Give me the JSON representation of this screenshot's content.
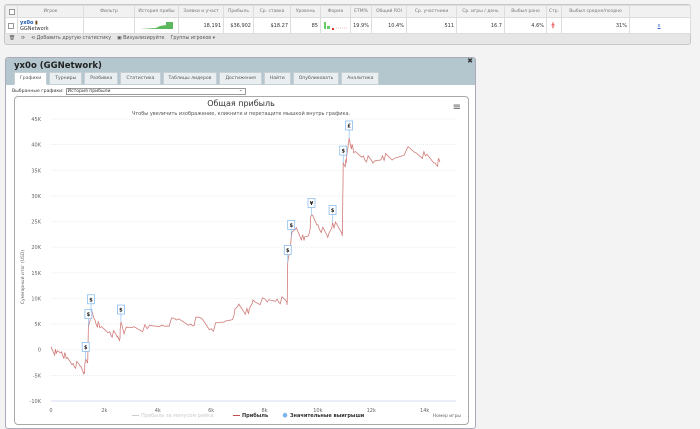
{
  "table": {
    "headers": [
      "",
      "Игрок",
      "Фильтр",
      "История прибы",
      "Заявки и участ",
      "Прибыль",
      "Ср. ставка",
      "Уровень",
      "Форма",
      "ЕТМ%",
      "Общий ROI",
      "Ср. участники",
      "Ср. игры / день",
      "Выбыл рано",
      "Стр.",
      "Выбыл средне/поздно",
      ""
    ],
    "row": {
      "player": "yx0o",
      "network": "GGNetwork",
      "entries": "18,191",
      "profit": "$36,902",
      "avg_stake": "$18.27",
      "level": "85",
      "etm": "19.9%",
      "roi": "10.4%",
      "avg_field": "511",
      "games_per_day": "16.7",
      "early": "4.6%",
      "late": "31%",
      "link": "x"
    },
    "toolbar": {
      "add_stat": "Добавить другую статистику",
      "visualize": "Визуализируйте",
      "groups": "Группы игроков ▾"
    }
  },
  "panel": {
    "title": "yx0o (GGNetwork)",
    "tabs": [
      "Графики",
      "Турниры",
      "Разбивка",
      "Статистика",
      "Таблицы лидеров",
      "Достижения",
      "Найти",
      "Опубликовать",
      "Аналитика"
    ],
    "active_tab": 0,
    "select_label": "Выбранные графики:",
    "select_value": "История прибыли"
  },
  "chart_data": {
    "type": "line",
    "title": "Общая прибыль",
    "subtitle": "Чтобы увеличить изображение, кликните и перетащите мышкой внутрь графика.",
    "xlabel": "Номер игры",
    "ylabel": "Суммарный итог (USD)",
    "xlim": [
      0,
      14800
    ],
    "ylim": [
      -10000,
      45000
    ],
    "xticks": [
      "0",
      "2k",
      "4k",
      "6k",
      "8k",
      "10k",
      "12k",
      "14k"
    ],
    "yticks": [
      "-10K",
      "-5K",
      "0",
      "5K",
      "10K",
      "15K",
      "20K",
      "25K",
      "30K",
      "35K",
      "40K",
      "45K"
    ],
    "grid": true,
    "legend": [
      "Прибыль за минусом рейка",
      "Прибыль",
      "Значительные выигрыши"
    ],
    "legend_position": "bottom",
    "colors": {
      "profit": "#c0504d",
      "rake": "#cccccc",
      "wins": "#7cb5ec"
    },
    "series": [
      {
        "name": "Прибыль",
        "x": [
          0,
          200,
          400,
          570,
          830,
          1100,
          1250,
          1300,
          1380,
          1400,
          1500,
          1650,
          1830,
          2200,
          2480,
          2580,
          2620,
          2760,
          3100,
          3600,
          4150,
          4700,
          5240,
          5600,
          6000,
          6500,
          6860,
          7040,
          7400,
          7570,
          8100,
          8470,
          8830,
          8850,
          8870,
          9000,
          9190,
          9480,
          9660,
          9760,
          10000,
          10370,
          10550,
          10880,
          10920,
          10950,
          11060,
          11170,
          11340,
          11700,
          12060,
          12420,
          12780,
          13320,
          13680,
          14030,
          14400,
          14570
        ],
        "y": [
          600,
          -800,
          -400,
          -1700,
          -2700,
          -3300,
          -4300,
          -1900,
          -1900,
          4500,
          7400,
          5800,
          4300,
          3500,
          2500,
          2300,
          5400,
          3500,
          4500,
          4100,
          4800,
          5800,
          5000,
          6200,
          4100,
          5400,
          6800,
          8900,
          7000,
          9700,
          9300,
          9900,
          9300,
          9300,
          17000,
          21900,
          23800,
          21300,
          22500,
          26200,
          24400,
          21900,
          24800,
          22900,
          22900,
          36400,
          36400,
          41300,
          38400,
          37800,
          36400,
          37800,
          37000,
          39000,
          38400,
          37800,
          36400,
          36600
        ]
      }
    ],
    "markers": [
      {
        "x": 1300,
        "y": -1900,
        "symbol": "$"
      },
      {
        "x": 1400,
        "y": 4500,
        "symbol": "$"
      },
      {
        "x": 1500,
        "y": 7400,
        "symbol": "$"
      },
      {
        "x": 2620,
        "y": 5400,
        "symbol": "$"
      },
      {
        "x": 8870,
        "y": 17000,
        "symbol": "$"
      },
      {
        "x": 9000,
        "y": 21900,
        "symbol": "$"
      },
      {
        "x": 9760,
        "y": 26200,
        "symbol": "¥"
      },
      {
        "x": 10550,
        "y": 24800,
        "symbol": "$"
      },
      {
        "x": 10950,
        "y": 36400,
        "symbol": "$"
      },
      {
        "x": 11170,
        "y": 41300,
        "symbol": "£"
      }
    ]
  }
}
